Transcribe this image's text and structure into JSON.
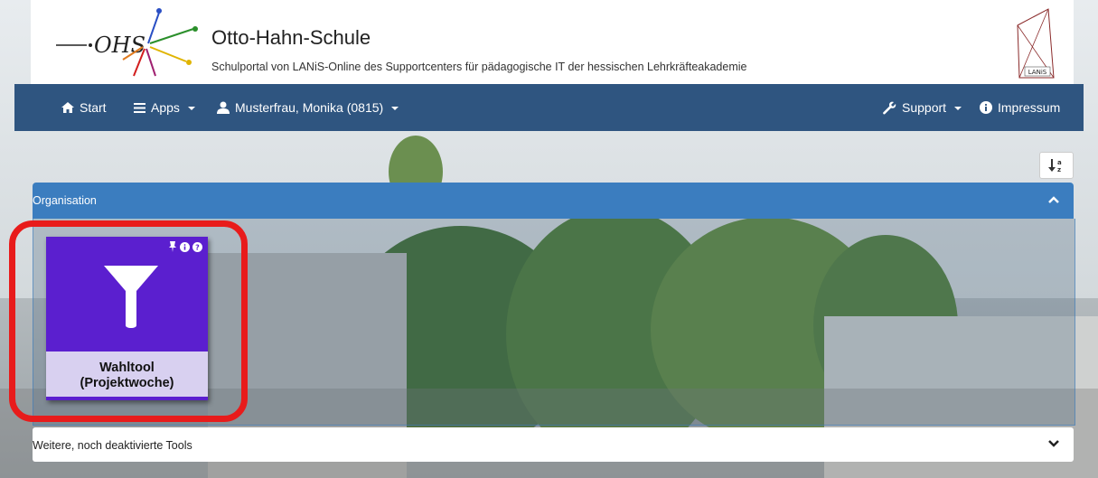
{
  "header": {
    "title": "Otto-Hahn-Schule",
    "subtitle": "Schulportal von LANiS-Online des Supportcenters für pädagogische IT der hessischen Lehrkräfteakademie",
    "logo_text": "OHS",
    "lanis_logo_text": "LANiS"
  },
  "navbar": {
    "start": "Start",
    "apps": "Apps",
    "user": "Musterfrau, Monika (0815)",
    "support": "Support",
    "impressum": "Impressum"
  },
  "sort_button": {
    "icon": "sort-alpha-icon",
    "label": "↓ᵃz"
  },
  "panels": {
    "organisation": {
      "label": "Organisation",
      "state": "expanded"
    },
    "inactive": {
      "label": "Weitere, noch deaktivierte Tools",
      "state": "collapsed"
    }
  },
  "tile": {
    "line1": "Wahltool",
    "line2": "(Projektwoche)",
    "icon": "filter-icon",
    "color": "#5b1fcf",
    "caption_bg": "#d8d0f0"
  },
  "colors": {
    "navbar": "#2f5580",
    "panel_header": "#3b7dbf",
    "highlight": "#e81b1b"
  }
}
